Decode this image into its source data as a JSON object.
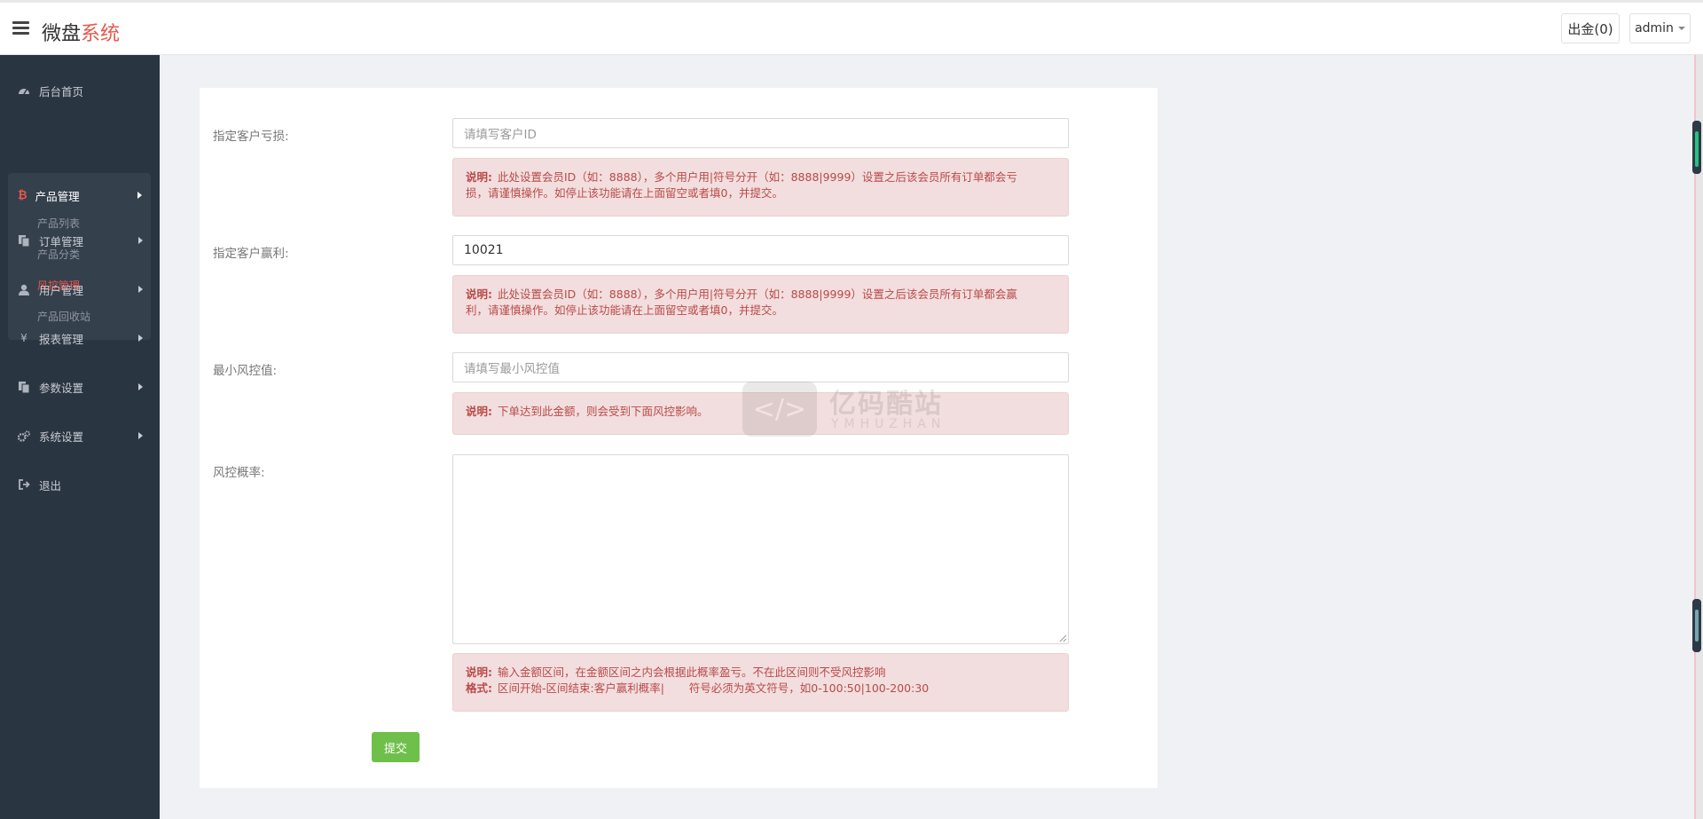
{
  "header": {
    "brand_main": "微盘",
    "brand_accent": "系统",
    "withdraw_label": "出金(0)",
    "user_label": "admin"
  },
  "sidebar": {
    "items": [
      {
        "label": "后台首页",
        "icon": "dashboard-icon"
      },
      {
        "label": "订单管理",
        "icon": "copy-icon"
      },
      {
        "label": "用户管理",
        "icon": "user-icon"
      },
      {
        "label": "报表管理",
        "icon": "yen-icon"
      },
      {
        "label": "参数设置",
        "icon": "copy-icon"
      },
      {
        "label": "系统设置",
        "icon": "gears-icon"
      },
      {
        "label": "退出",
        "icon": "sign-out-icon"
      }
    ],
    "group": {
      "label": "产品管理",
      "icon": "bitcoin-icon",
      "subitems": [
        "产品列表",
        "产品分类",
        "风控管理",
        "产品回收站"
      ],
      "active": "风控管理"
    }
  },
  "form": {
    "loss": {
      "label": "指定客户亏损:",
      "placeholder": "请填写客户ID",
      "value": "",
      "note_label": "说明:",
      "note_line1": "此处设置会员ID（如：8888），多个用户用|符号分开（如：8888|9999）设置之后该会员所有订单都会亏",
      "note_line2": "损，请谨慎操作。如停止该功能请在上面留空或者填0，并提交。"
    },
    "profit": {
      "label": "指定客户赢利:",
      "placeholder": "",
      "value": "10021",
      "note_label": "说明:",
      "note_line1": "此处设置会员ID（如：8888），多个用户用|符号分开（如：8888|9999）设置之后该会员所有订单都会赢",
      "note_line2": "利，请谨慎操作。如停止该功能请在上面留空或者填0，并提交。"
    },
    "min_risk": {
      "label": "最小风控值:",
      "placeholder": "请填写最小风控值",
      "note_label": "说明:",
      "note_line1": "下单达到此金额，则会受到下面风控影响。"
    },
    "probability": {
      "label": "风控概率:",
      "value": "",
      "note_label1": "说明:",
      "note_line1": "输入金额区间，在金额区间之内会根据此概率盈亏。不在此区间则不受风控影响",
      "note_label2": "格式:",
      "note_line2": "区间开始-区间结束:客户赢利概率|       符号必须为英文符号，如0-100:50|100-200:30"
    },
    "submit_label": "提交"
  },
  "watermark": {
    "symbol": "</>",
    "title": "亿码酷站",
    "subtitle": "YMHUZHAN"
  },
  "colors": {
    "accent": "#e8574a",
    "sidebar_bg": "#2a3542",
    "note_bg": "#f2dede",
    "note_text": "#b94a48",
    "submit_bg": "#6fbf4b"
  }
}
